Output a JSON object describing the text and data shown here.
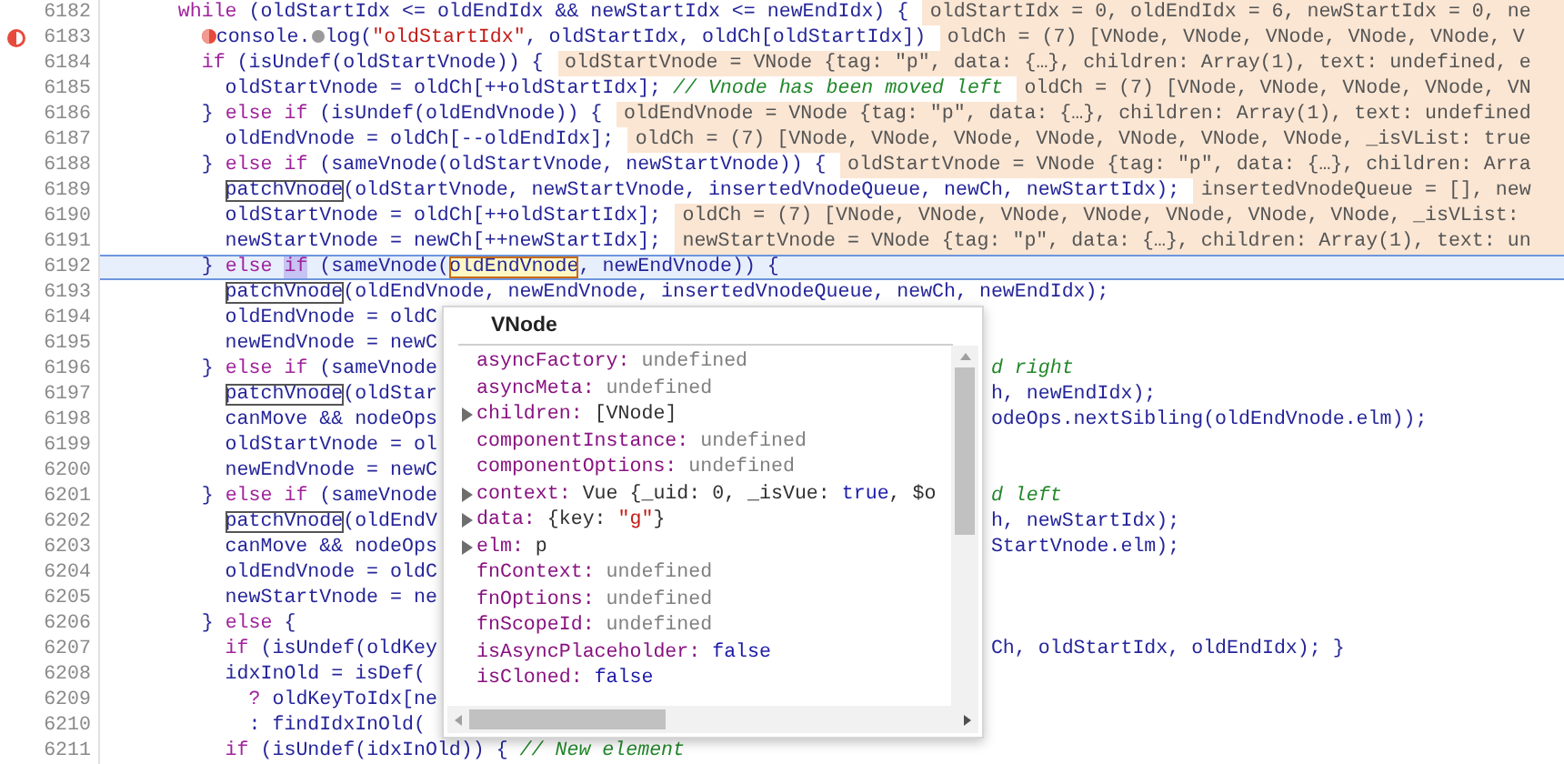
{
  "lines": [
    {
      "number": "6182",
      "breakpoint": false,
      "current": false,
      "code": [
        {
          "kind": "keyword",
          "text": "      while"
        },
        {
          "kind": "plain",
          "text": " (oldStartIdx <= oldEndIdx && newStartIdx <= newEndIdx) {"
        }
      ],
      "preview": "oldStartIdx = 0, oldEndIdx = 6, newStartIdx = 0, ne"
    },
    {
      "number": "6183",
      "breakpoint": true,
      "current": false,
      "code": [
        {
          "kind": "break-mark"
        },
        {
          "kind": "plain",
          "text": "        console."
        },
        {
          "kind": "pause-mark"
        },
        {
          "kind": "plain",
          "text": "log("
        },
        {
          "kind": "string",
          "text": "\"oldStartIdx\""
        },
        {
          "kind": "plain",
          "text": ", oldStartIdx, oldCh[oldStartIdx])"
        }
      ],
      "preview": "oldCh = (7) [VNode, VNode, VNode, VNode, VNode, V"
    },
    {
      "number": "6184",
      "breakpoint": false,
      "current": false,
      "code": [
        {
          "kind": "keyword",
          "text": "        if"
        },
        {
          "kind": "plain",
          "text": " (isUndef(oldStartVnode)) {"
        }
      ],
      "preview": "oldStartVnode = VNode {tag: \"p\", data: {…}, children: Array(1), text: undefined, e"
    },
    {
      "number": "6185",
      "breakpoint": false,
      "current": false,
      "code": [
        {
          "kind": "plain",
          "text": "          oldStartVnode = oldCh[++oldStartIdx]; "
        },
        {
          "kind": "comment",
          "text": "// Vnode has been moved left"
        }
      ],
      "preview": "oldCh = (7) [VNode, VNode, VNode, VNode, VN"
    },
    {
      "number": "6186",
      "breakpoint": false,
      "current": false,
      "code": [
        {
          "kind": "plain",
          "text": "        } "
        },
        {
          "kind": "keyword",
          "text": "else if"
        },
        {
          "kind": "plain",
          "text": " (isUndef(oldEndVnode)) {"
        }
      ],
      "preview": "oldEndVnode = VNode {tag: \"p\", data: {…}, children: Array(1), text: undefined"
    },
    {
      "number": "6187",
      "breakpoint": false,
      "current": false,
      "code": [
        {
          "kind": "plain",
          "text": "          oldEndVnode = oldCh[--oldEndIdx];"
        }
      ],
      "preview": "oldCh = (7) [VNode, VNode, VNode, VNode, VNode, VNode, VNode, _isVList: true"
    },
    {
      "number": "6188",
      "breakpoint": false,
      "current": false,
      "code": [
        {
          "kind": "plain",
          "text": "        } "
        },
        {
          "kind": "keyword",
          "text": "else if"
        },
        {
          "kind": "plain",
          "text": " (sameVnode(oldStartVnode, newStartVnode)) {"
        }
      ],
      "preview": "oldStartVnode = VNode {tag: \"p\", data: {…}, children: Arra"
    },
    {
      "number": "6189",
      "breakpoint": false,
      "current": false,
      "code": [
        {
          "kind": "boxed",
          "text": "          patchVnode"
        },
        {
          "kind": "plain",
          "text": "(oldStartVnode, newStartVnode, insertedVnodeQueue, newCh, newStartIdx);"
        }
      ],
      "preview": "insertedVnodeQueue = [], new"
    },
    {
      "number": "6190",
      "breakpoint": false,
      "current": false,
      "code": [
        {
          "kind": "plain",
          "text": "          oldStartVnode = oldCh[++oldStartIdx];"
        }
      ],
      "preview": "oldCh = (7) [VNode, VNode, VNode, VNode, VNode, VNode, VNode, _isVList: "
    },
    {
      "number": "6191",
      "breakpoint": false,
      "current": false,
      "code": [
        {
          "kind": "plain",
          "text": "          newStartVnode = newCh[++newStartIdx];"
        }
      ],
      "preview": "newStartVnode = VNode {tag: \"p\", data: {…}, children: Array(1), text: un"
    },
    {
      "number": "6192",
      "breakpoint": false,
      "current": true,
      "code": [
        {
          "kind": "plain",
          "text": "        } "
        },
        {
          "kind": "keyword",
          "text": "else"
        },
        {
          "kind": "selected",
          "text": " if"
        },
        {
          "kind": "plain",
          "text": " (sameVnode("
        },
        {
          "kind": "found",
          "text": "oldEndVnode"
        },
        {
          "kind": "plain",
          "text": ", newEndVnode)) {"
        }
      ]
    },
    {
      "number": "6193",
      "breakpoint": false,
      "current": false,
      "code": [
        {
          "kind": "boxed",
          "text": "          patchVnode"
        },
        {
          "kind": "plain",
          "text": "(oldEndVnode, newEndVnode, insertedVnodeQueue, newCh, newEndIdx);"
        }
      ]
    },
    {
      "number": "6194",
      "breakpoint": false,
      "current": false,
      "code": [
        {
          "kind": "plain",
          "text": "          oldEndVnode = oldC"
        }
      ]
    },
    {
      "number": "6195",
      "breakpoint": false,
      "current": false,
      "code": [
        {
          "kind": "plain",
          "text": "          newEndVnode = newC"
        }
      ]
    },
    {
      "number": "6196",
      "breakpoint": false,
      "current": false,
      "code": [
        {
          "kind": "plain",
          "text": "        } "
        },
        {
          "kind": "keyword",
          "text": "else if"
        },
        {
          "kind": "plain",
          "text": " (sameVnode"
        }
      ],
      "tail": [
        {
          "kind": "comment",
          "text": "d right"
        }
      ]
    },
    {
      "number": "6197",
      "breakpoint": false,
      "current": false,
      "code": [
        {
          "kind": "boxed",
          "text": "          patchVnode"
        },
        {
          "kind": "plain",
          "text": "(oldStar"
        }
      ],
      "tail": [
        {
          "kind": "plain",
          "text": "h, newEndIdx);"
        }
      ]
    },
    {
      "number": "6198",
      "breakpoint": false,
      "current": false,
      "code": [
        {
          "kind": "plain",
          "text": "          canMove && nodeOps"
        }
      ],
      "tail": [
        {
          "kind": "plain",
          "text": "odeOps.nextSibling(oldEndVnode.elm));"
        }
      ]
    },
    {
      "number": "6199",
      "breakpoint": false,
      "current": false,
      "code": [
        {
          "kind": "plain",
          "text": "          oldStartVnode = ol"
        }
      ]
    },
    {
      "number": "6200",
      "breakpoint": false,
      "current": false,
      "code": [
        {
          "kind": "plain",
          "text": "          newEndVnode = newC"
        }
      ]
    },
    {
      "number": "6201",
      "breakpoint": false,
      "current": false,
      "code": [
        {
          "kind": "plain",
          "text": "        } "
        },
        {
          "kind": "keyword",
          "text": "else if"
        },
        {
          "kind": "plain",
          "text": " (sameVnode"
        }
      ],
      "tail": [
        {
          "kind": "comment",
          "text": "d left"
        }
      ]
    },
    {
      "number": "6202",
      "breakpoint": false,
      "current": false,
      "code": [
        {
          "kind": "boxed",
          "text": "          patchVnode"
        },
        {
          "kind": "plain",
          "text": "(oldEndV"
        }
      ],
      "tail": [
        {
          "kind": "plain",
          "text": "h, newStartIdx);"
        }
      ]
    },
    {
      "number": "6203",
      "breakpoint": false,
      "current": false,
      "code": [
        {
          "kind": "plain",
          "text": "          canMove && nodeOps"
        }
      ],
      "tail": [
        {
          "kind": "plain",
          "text": "StartVnode.elm);"
        }
      ]
    },
    {
      "number": "6204",
      "breakpoint": false,
      "current": false,
      "code": [
        {
          "kind": "plain",
          "text": "          oldEndVnode = oldC"
        }
      ]
    },
    {
      "number": "6205",
      "breakpoint": false,
      "current": false,
      "code": [
        {
          "kind": "plain",
          "text": "          newStartVnode = ne"
        }
      ]
    },
    {
      "number": "6206",
      "breakpoint": false,
      "current": false,
      "code": [
        {
          "kind": "plain",
          "text": "        } "
        },
        {
          "kind": "keyword",
          "text": "else"
        },
        {
          "kind": "plain",
          "text": " {"
        }
      ]
    },
    {
      "number": "6207",
      "breakpoint": false,
      "current": false,
      "code": [
        {
          "kind": "keyword",
          "text": "          if"
        },
        {
          "kind": "plain",
          "text": " (isUndef(oldKey"
        }
      ],
      "tail": [
        {
          "kind": "plain",
          "text": "Ch, oldStartIdx, oldEndIdx); }"
        }
      ]
    },
    {
      "number": "6208",
      "breakpoint": false,
      "current": false,
      "code": [
        {
          "kind": "plain",
          "text": "          idxInOld = isDef("
        }
      ]
    },
    {
      "number": "6209",
      "breakpoint": false,
      "current": false,
      "code": [
        {
          "kind": "keyword",
          "text": "            ?"
        },
        {
          "kind": "plain",
          "text": " oldKeyToIdx[ne"
        }
      ]
    },
    {
      "number": "6210",
      "breakpoint": false,
      "current": false,
      "code": [
        {
          "kind": "plain",
          "text": "            : findIdxInOld("
        }
      ]
    },
    {
      "number": "6211",
      "breakpoint": false,
      "current": false,
      "code": [
        {
          "kind": "keyword",
          "text": "          if"
        },
        {
          "kind": "plain",
          "text": " (isUndef(idxInOld)) { "
        },
        {
          "kind": "comment",
          "text": "// New element"
        }
      ]
    }
  ],
  "popover": {
    "title": "VNode",
    "properties": [
      {
        "name": "asyncFactory:",
        "expandable": false,
        "value": [
          {
            "kind": "undefined",
            "text": "undefined"
          }
        ]
      },
      {
        "name": "asyncMeta:",
        "expandable": false,
        "value": [
          {
            "kind": "undefined",
            "text": "undefined"
          }
        ]
      },
      {
        "name": "children:",
        "expandable": true,
        "value": [
          {
            "kind": "plain",
            "text": "[VNode]"
          }
        ]
      },
      {
        "name": "componentInstance:",
        "expandable": false,
        "value": [
          {
            "kind": "undefined",
            "text": "undefined"
          }
        ]
      },
      {
        "name": "componentOptions:",
        "expandable": false,
        "value": [
          {
            "kind": "undefined",
            "text": "undefined"
          }
        ]
      },
      {
        "name": "context:",
        "expandable": true,
        "value": [
          {
            "kind": "plain",
            "text": "Vue {_uid: 0, _isVue: "
          },
          {
            "kind": "boolean",
            "text": "true"
          },
          {
            "kind": "plain",
            "text": ", $o"
          }
        ]
      },
      {
        "name": "data:",
        "expandable": true,
        "value": [
          {
            "kind": "plain",
            "text": "{key: "
          },
          {
            "kind": "string",
            "text": "\"g\""
          },
          {
            "kind": "plain",
            "text": "}"
          }
        ]
      },
      {
        "name": "elm:",
        "expandable": true,
        "value": [
          {
            "kind": "plain",
            "text": "p"
          }
        ]
      },
      {
        "name": "fnContext:",
        "expandable": false,
        "value": [
          {
            "kind": "undefined",
            "text": "undefined"
          }
        ]
      },
      {
        "name": "fnOptions:",
        "expandable": false,
        "value": [
          {
            "kind": "undefined",
            "text": "undefined"
          }
        ]
      },
      {
        "name": "fnScopeId:",
        "expandable": false,
        "value": [
          {
            "kind": "undefined",
            "text": "undefined"
          }
        ]
      },
      {
        "name": "isAsyncPlaceholder:",
        "expandable": false,
        "value": [
          {
            "kind": "boolean",
            "text": "false"
          }
        ]
      },
      {
        "name": "isCloned:",
        "expandable": false,
        "value": [
          {
            "kind": "boolean",
            "text": "false"
          }
        ]
      }
    ]
  }
}
